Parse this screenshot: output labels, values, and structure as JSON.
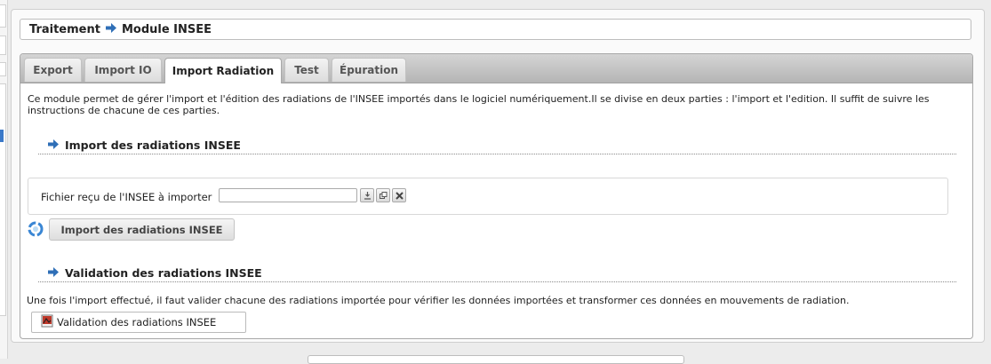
{
  "breadcrumb": {
    "parent": "Traitement",
    "current": "Module INSEE"
  },
  "tabs": [
    {
      "label": "Export",
      "active": false
    },
    {
      "label": "Import IO",
      "active": false
    },
    {
      "label": "Import Radiation",
      "active": true
    },
    {
      "label": "Test",
      "active": false
    },
    {
      "label": "Épuration",
      "active": false
    }
  ],
  "intro": "Ce module permet de gérer l'import et l'édition des radiations de l'INSEE importés dans le logiciel numériquement.Il se divise en deux parties : l'import et l'edition. Il suffit de suivre les instructions de chacune de ces parties.",
  "import_section": {
    "title": "Import des radiations INSEE",
    "file_label": "Fichier reçu de l'INSEE à importer",
    "file_value": "",
    "download_icon": "download-icon",
    "copy_icon": "copy-icon",
    "clear_icon": "clear-icon",
    "button_label": "Import des radiations INSEE"
  },
  "validation_section": {
    "title": "Validation des radiations INSEE",
    "description": "Une fois l'import effectué, il faut valider chacune des radiations importée pour vérifier les données importées et transformer ces données en mouvements de radiation.",
    "button_label": "Validation des radiations INSEE"
  },
  "colors": {
    "arrow_blue": "#2f6fb7",
    "tab_bar": "#c4c4c4",
    "accent_selection": "#3a78c8"
  }
}
